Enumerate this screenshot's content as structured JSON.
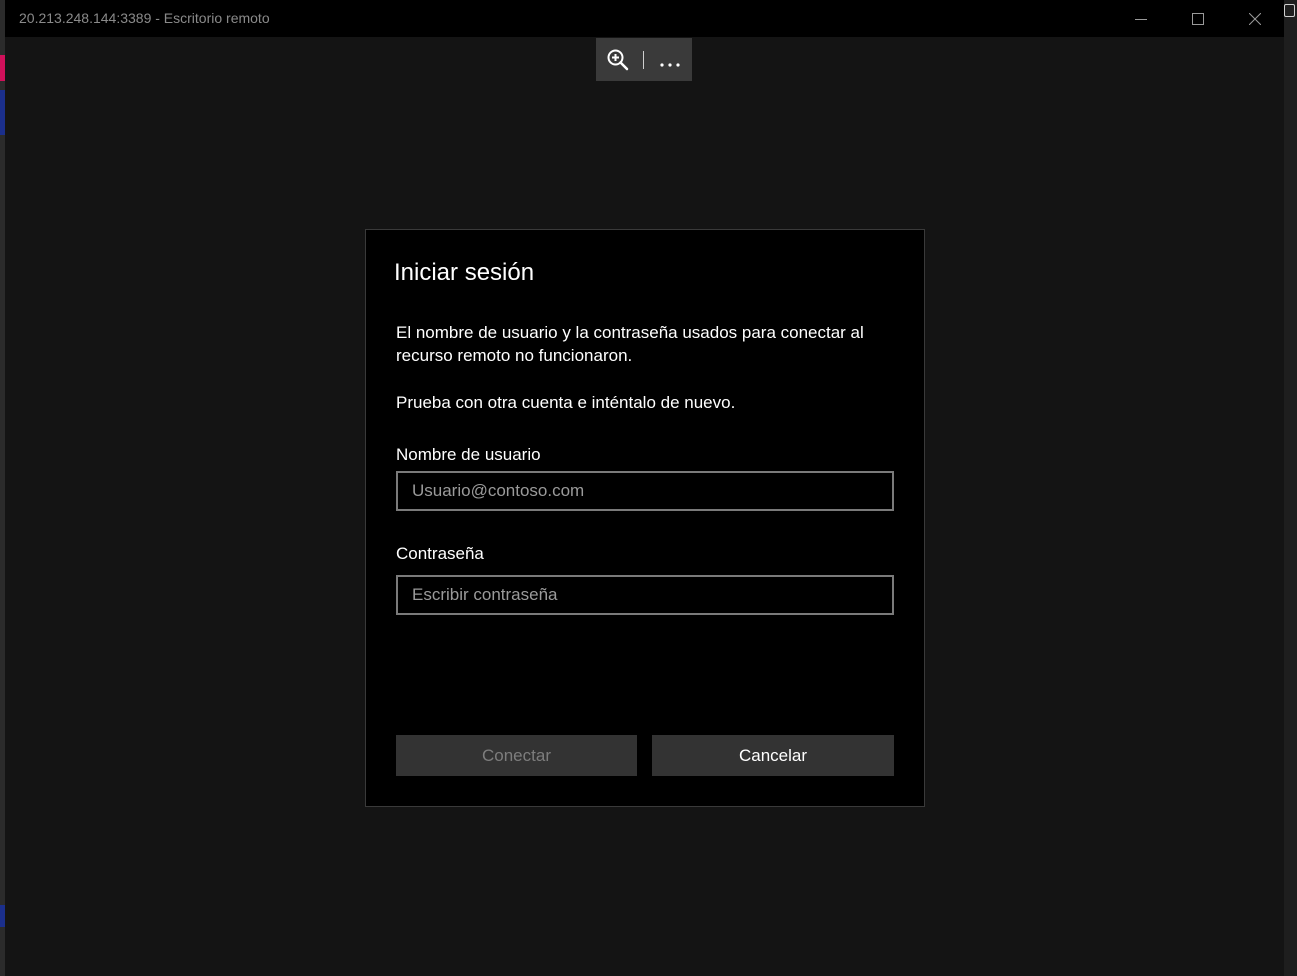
{
  "window": {
    "title": "20.213.248.144:3389 - Escritorio remoto",
    "controls": {
      "minimize": "minimize-icon",
      "maximize": "maximize-icon",
      "close": "close-icon"
    }
  },
  "toolbar": {
    "zoom_icon": "zoom-in-icon",
    "more_icon": "more-icon"
  },
  "dialog": {
    "title": "Iniciar sesión",
    "message": "El nombre de usuario y la contraseña usados para conectar al recurso remoto no funcionaron.",
    "hint": "Prueba con otra cuenta e inténtalo de nuevo.",
    "username": {
      "label": "Nombre de usuario",
      "value": "",
      "placeholder": "Usuario@contoso.com"
    },
    "password": {
      "label": "Contraseña",
      "value": "",
      "placeholder": "Escribir contraseña"
    },
    "buttons": {
      "connect": "Conectar",
      "cancel": "Cancelar"
    }
  },
  "colors": {
    "window_bg": "#141414",
    "dialog_bg": "#000000",
    "button_bg": "#333333",
    "disabled_text": "#7d7d7d",
    "input_border": "#7a7a7a"
  }
}
